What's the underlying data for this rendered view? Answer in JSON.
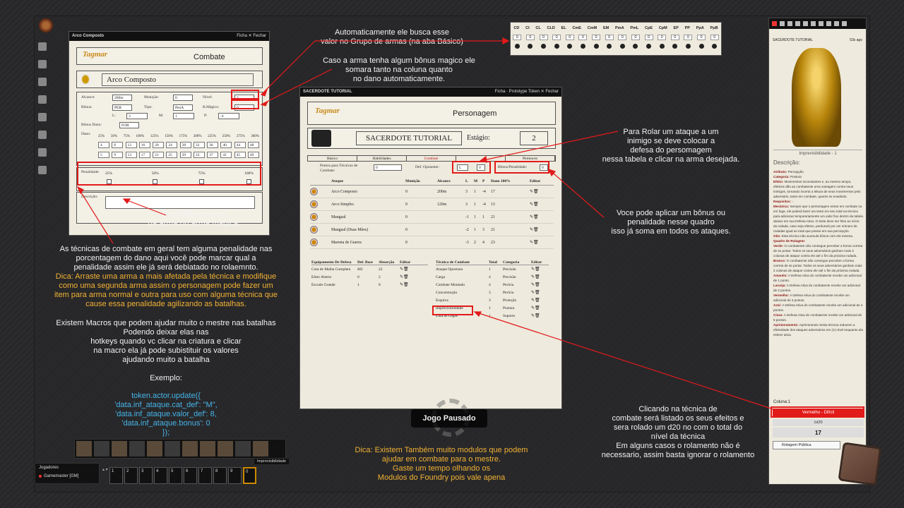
{
  "annotations": {
    "busca_grupo": [
      "Automaticamente ele busca esse",
      "valor no Grupo de armas (na aba Básico)"
    ],
    "bonus_magico": [
      "Caso a arma tenha algum bônus magico ele",
      "somara tanto na coluna quanto",
      "no dano automaticamente."
    ],
    "descricao": [
      "Decrição especial",
      "da arma ou arma mágica."
    ],
    "penalidade": [
      "As técnicas de combate em geral tem alguma penalidade nas",
      "porcentagem do dano aqui você pode marcar qual a",
      "penalidade assim ele já será debiatado no rolaemnto."
    ],
    "dica1": [
      "Dica: Arraste uma arma a mais afetada pela técnica e modifique",
      "como uma segunda arma assim o personagem pode fazer um",
      "item para arma normal e outra para uso com alguma técnica que",
      "cause essa penalidade agilizando as batalhas."
    ],
    "macros": [
      "Existem Macros que podem ajudar muito o mestre nas batalhas",
      "Podendo deixar elas nas",
      "hotkeys quando vc clicar na criatura e clicar",
      "na macro ela já pode subistituir os valores",
      "ajudando muito a batalha"
    ],
    "exemplo": "Exemplo:",
    "code": [
      "token.actor.update({",
      "'data.inf_ataque.cat_def': \"M\",",
      "'data.inf_ataque.valor_def': 8,",
      "'data.inf_ataque.bonus': 0",
      "});"
    ],
    "rolar": [
      "Para Rolar um ataque a um",
      "inimigo se deve colocar a",
      "defesa do persomagem",
      "nessa tabela e clicar na arma desejada."
    ],
    "bonus_quadro": [
      "Voce pode aplicar um bônus ou",
      "penalidade nesse quadro",
      "isso já soma em todos os ataques."
    ],
    "clicando": [
      "Clicando na técnica de",
      "combate será listado os seus efeitos e",
      "sera rolado um d20 no com o total do",
      "nível da técnica",
      "Em alguns casos o rolamento não é",
      "necessario, assim basta ignorar o rolamento"
    ],
    "dica2": [
      "Dica: Existem Também muito modulos que podem",
      "ajudar em combate para o mestre.",
      "Gaste um tempo olhando os",
      "Modulos do Foundry pois vale apena"
    ]
  },
  "defense_table": {
    "headers": [
      "CD",
      "CI",
      "CL",
      "CLD",
      "EL",
      "CmE",
      "CmM",
      "EM",
      "PmA",
      "PmL",
      "CpE",
      "CpM",
      "EP",
      "PP",
      "PpA",
      "PpB"
    ],
    "values": [
      "0",
      "0",
      "0",
      "0",
      "0",
      "0",
      "0",
      "0",
      "0",
      "0",
      "0",
      "0",
      "0",
      "0",
      "0",
      "0"
    ]
  },
  "weapon_sheet": {
    "title": "Arco Composto",
    "ficha": "Ficha",
    "fechar": "Fechar",
    "logo": "Tagmar",
    "tab": "Combate",
    "name": "Arco Composto",
    "alcance_label": "Alcance:",
    "alcance": "200m",
    "municao_label": "Munição:",
    "municao": "0",
    "nivel_label": "Nível:",
    "nivel": "2",
    "bonus_label": "Bônus:",
    "bonus": "PER",
    "tipo_label": "Tipo:",
    "tipo": "PenA",
    "bmagico_label": "B.Mágico:",
    "bmagico": "0",
    "l_label": "L:",
    "l": "3",
    "m_label": "M:",
    "m": "1",
    "p_label": "P:",
    "p": "-4",
    "bonus_dano_label": "Bônus Dano:",
    "bonus_dano": "FOR",
    "dano_label": "Dano:",
    "dano_headers": [
      "25%",
      "50%",
      "75%",
      "100%",
      "125%",
      "150%",
      "175%",
      "200%",
      "225%",
      "250%",
      "275%",
      "300%"
    ],
    "dano_row1": [
      "4",
      "8",
      "12",
      "16",
      "20",
      "24",
      "28",
      "32",
      "36",
      "40",
      "44",
      "48"
    ],
    "dano_row2": [
      "5",
      "9",
      "13",
      "17",
      "21",
      "25",
      "29",
      "33",
      "37",
      "41",
      "45",
      "49"
    ],
    "penalidade_label": "Penalidade:",
    "penalidade": [
      "25%",
      "50%",
      "75%",
      "100%"
    ],
    "descricao_label": "Descrição:"
  },
  "char_sheet": {
    "header": "SACERDOTE TUTORIAL",
    "ficha": "Ficha",
    "prototype": "Prototype Token",
    "fechar": "Fechar",
    "logo": "Tagmar",
    "title": "Personagem",
    "name": "SACERDOTE TUTORIAL",
    "estagio_label": "Estágio:",
    "estagio": "2",
    "tabs": [
      "Básico",
      "Habilidades",
      "Combate",
      "",
      "Pertences"
    ],
    "pontos_label": "Pontos para Técnicas de Combate:",
    "pontos": "0",
    "def_label": "Def. Oponente:",
    "def_cat": "L",
    "def_val": "0",
    "bonus_label": "Bônus/Penalidade:",
    "bonus_val": "0",
    "weapons_headers": [
      "Ataque",
      "Munição",
      "Alcance",
      "L",
      "M",
      "P",
      "Dano 100%",
      "Editar"
    ],
    "weapons": [
      {
        "name": "Arco Composto",
        "mun": "0",
        "alc": "200m",
        "l": "3",
        "m": "1",
        "p": "-4",
        "dano": "17"
      },
      {
        "name": "Arco Simples",
        "mun": "0",
        "alc": "120m",
        "l": "3",
        "m": "1",
        "p": "-4",
        "dano": "13"
      },
      {
        "name": "Mangual",
        "mun": "0",
        "alc": "",
        "l": "-1",
        "m": "1",
        "p": "1",
        "dano": "21"
      },
      {
        "name": "Mangual (Duas Mãos)",
        "mun": "0",
        "alc": "",
        "l": "-2",
        "m": "1",
        "p": "3",
        "dano": "21"
      },
      {
        "name": "Marreta de Guerra",
        "mun": "0",
        "alc": "",
        "l": "-3",
        "m": "2",
        "p": "4",
        "dano": "23"
      }
    ],
    "armor_headers": [
      "Equipamento De Defesa",
      "Def. Base",
      "Absorção",
      "Editar"
    ],
    "armor": [
      {
        "name": "Cota de Malha Completa",
        "def": "M2",
        "abs": "22"
      },
      {
        "name": "Elmo Aberto",
        "def": "0",
        "abs": "2"
      },
      {
        "name": "Escudo Grande",
        "def": "1",
        "abs": "8"
      }
    ],
    "tech_headers": [
      "Técnica de Combate",
      "Total",
      "Categoria",
      "Editar"
    ],
    "techs": [
      {
        "name": "Ataque Oportuno",
        "total": "1",
        "cat": "Precisão"
      },
      {
        "name": "Carga",
        "total": "4",
        "cat": "Precisão"
      },
      {
        "name": "Combate Montado",
        "total": "4",
        "cat": "Perícia"
      },
      {
        "name": "Concentração",
        "total": "3",
        "cat": "Perícia"
      },
      {
        "name": "Esquiva",
        "total": "3",
        "cat": "Proteção"
      },
      {
        "name": "Imprevisibilidade",
        "total": "1",
        "cat": "Postura"
      },
      {
        "name": "Luta às Cegas",
        "total": "1",
        "cat": "Suporte"
      }
    ]
  },
  "chat": {
    "card_title": "SACERDOTE TUTORIAL",
    "time": "53s ago",
    "item": "Imprevisibilidade - 1",
    "desc_label": "Descrição:",
    "desc": [
      {
        "b": "Atributo:",
        "t": " Percepção"
      },
      {
        "b": "Categoria:",
        "t": " Postura"
      },
      {
        "b": "Efeito:",
        "t": " Movimentos inconstantes e, ao mesmo tempo, efetivos dão ao combatente uma vantagem contra seus inimigos, tornando incerta a leitura de seus movimentos pelo adversário, tanto em combate, quanto se evadindo."
      },
      {
        "b": "Requisitos:",
        "t": " -."
      },
      {
        "b": "Mecânica:",
        "t": " Sempre que o personagem entrar em combate ou em fuga, ele poderá fazer um teste em seu total na técnica para adicionar temporariamente um valor fixo dentro da tabela abaixo em sua Defesa Ativa. O teste deve ser feito ao início da rodada, caso seja efetivo, perdurará por um número de rodadas igual ao total que possui em sua percepção."
      },
      {
        "b": "Obs:",
        "t": " Esta técnica não acumula bônus com ela mesma."
      },
      {
        "b": "Quadro de Rolagem:",
        "t": ""
      },
      {
        "b": "Verde:",
        "t": " O combatente não consegue perceber a forma correta de se portar. Todos os seus adversários ganham mais 3 colunas de ataque contra ele até o fim da próxima rodada."
      },
      {
        "b": "Branco:",
        "t": " O combatente não consegue perceber a forma correta de se portar. Todos os seus adversários ganham mais 2 colunas de ataque contra ele até o fim da próxima rodada."
      },
      {
        "b": "Amarelo:",
        "t": " A Defesa Ativa do combatente recebe um adicional de 1 ponto."
      },
      {
        "b": "Laranja:",
        "t": " A Defesa Ativa do combatente recebe um adicional de 2 pontos."
      },
      {
        "b": "Vermelho:",
        "t": " A Defesa Ativa do combatente recebe um adicional de 3 pontos."
      },
      {
        "b": "Azul:",
        "t": " A Defesa Ativa do combatente recebe um adicional de 4 pontos."
      },
      {
        "b": "Cinza:",
        "t": " A Defesa Ativa do combatente recebe um adicional de 5 pontos."
      },
      {
        "b": "Aprimoramento:",
        "t": " Aprimorando nessa técnica reduzem a efetividade dos ataques adversários em (1) nível enquanto ela estiver ativa."
      }
    ],
    "coluna": "Coluna:1",
    "result": "Vermelho - Difícil",
    "formula": "1d20",
    "total": "17",
    "roll_mode": "Rolagem Pública"
  },
  "players": {
    "title": "Jogadores",
    "gm": "Gamemaster [GM]"
  },
  "hotbar": {
    "tooltip": "Imprevisibilidade",
    "slots": [
      "1",
      "2",
      "3",
      "4",
      "5",
      "6",
      "7",
      "8",
      "9",
      "0"
    ]
  },
  "pause": "Jogo Pausado",
  "colors": {
    "red": "#e21a1a",
    "yellow": "#f2b234",
    "blue": "#46b4ea"
  }
}
